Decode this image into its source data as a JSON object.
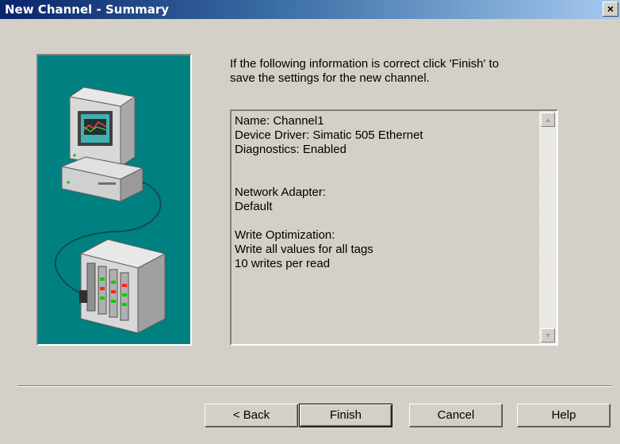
{
  "window": {
    "title": "New Channel - Summary",
    "close_glyph": "×"
  },
  "illustration": {
    "icon": "computer-connected-to-plc-icon",
    "background": "#008080"
  },
  "intro_text": "If the following information is correct click 'Finish' to\nsave the settings for the new channel.",
  "summary": {
    "text": "Name: Channel1\nDevice Driver: Simatic 505 Ethernet\nDiagnostics: Enabled\n\n\nNetwork Adapter:\nDefault\n\nWrite Optimization:\nWrite all values for all tags\n10 writes per read",
    "scroll_up_glyph": "▲",
    "scroll_down_glyph": "▼"
  },
  "buttons": {
    "back": "< Back",
    "finish": "Finish",
    "cancel": "Cancel",
    "help": "Help"
  },
  "colors": {
    "title_gradient_start": "#0a246a",
    "title_gradient_end": "#a6caf0",
    "dialog_face": "#d4d0c8"
  }
}
